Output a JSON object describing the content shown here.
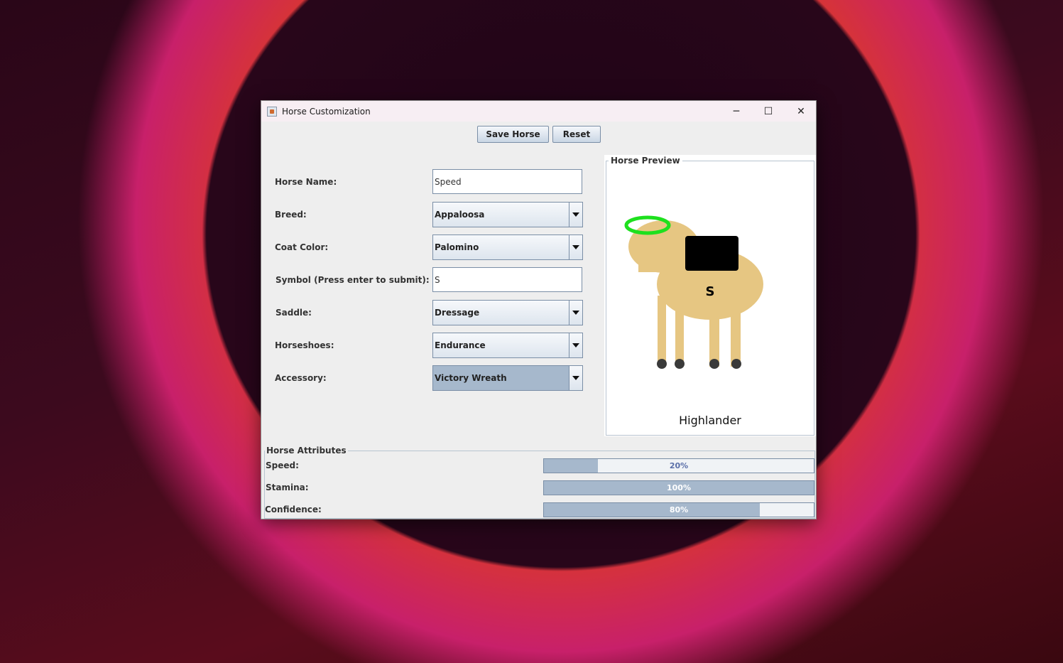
{
  "window": {
    "title": "Horse Customization",
    "controls": {
      "minimize": "─",
      "maximize": "☐",
      "close": "✕"
    }
  },
  "toolbar": {
    "save_label": "Save Horse",
    "reset_label": "Reset"
  },
  "form": {
    "name_label": "Horse Name:",
    "name_value": "Speed",
    "breed_label": "Breed:",
    "breed_value": "Appaloosa",
    "coat_label": "Coat Color:",
    "coat_value": "Palomino",
    "symbol_label": "Symbol (Press enter to submit):",
    "symbol_value": "S",
    "saddle_label": "Saddle:",
    "saddle_value": "Dressage",
    "horseshoes_label": "Horseshoes:",
    "horseshoes_value": "Endurance",
    "accessory_label": "Accessory:",
    "accessory_value": "Victory Wreath"
  },
  "preview": {
    "title": "Horse Preview",
    "symbol": "S",
    "breed_caption": "Highlander",
    "colors": {
      "coat": "#e6c682",
      "saddle": "#000000",
      "wreath": "#1ee01e",
      "hoof": "#3a3a3a"
    }
  },
  "attributes": {
    "title": "Horse Attributes",
    "items": [
      {
        "label": "Speed:",
        "value": 0.2,
        "text": "20%"
      },
      {
        "label": "Stamina:",
        "value": 1.0,
        "text": "100%"
      },
      {
        "label": "Confidence:",
        "value": 0.8,
        "text": "80%"
      }
    ]
  }
}
